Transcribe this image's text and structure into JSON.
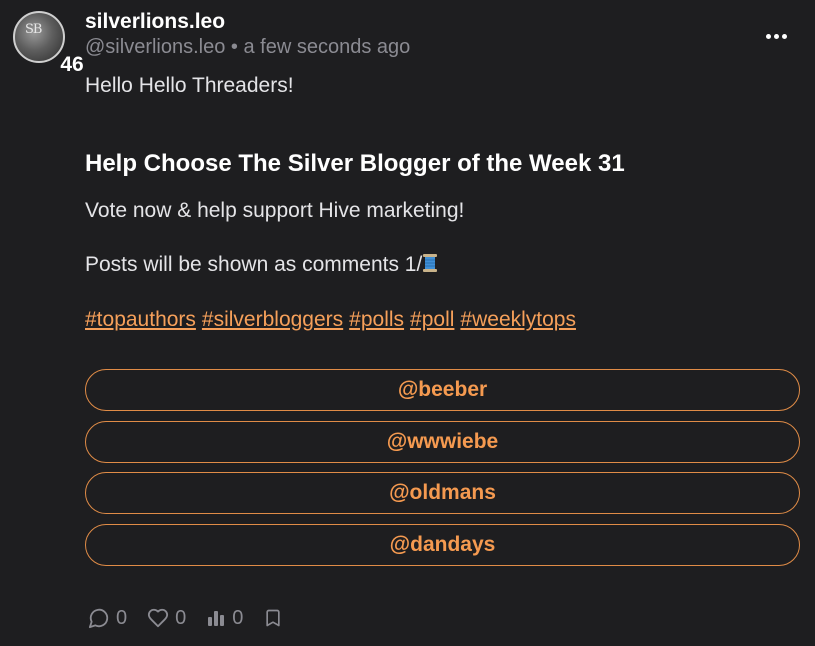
{
  "author": {
    "avatar_text": "SB",
    "reputation": "46",
    "name": "silverlions.leo",
    "handle": "@silverlions.leo",
    "separator": "•",
    "time": "a few seconds ago"
  },
  "menu": {
    "icon": "more-horizontal-icon"
  },
  "content": {
    "greeting": "Hello Hello Threaders!",
    "title": "Help Choose The Silver Blogger of the Week 31",
    "line1": "Vote now & help support Hive marketing!",
    "line2": "Posts will be shown as comments 1/",
    "line2_icon": "thread-spool-icon",
    "hashtags": [
      "#topauthors",
      "#silverbloggers",
      "#polls",
      "#poll",
      "#weeklytops"
    ]
  },
  "poll": {
    "options": [
      "@beeber",
      "@wwwiebe",
      "@oldmans",
      "@dandays"
    ]
  },
  "actions": {
    "comments": {
      "icon": "comment-icon",
      "count": "0"
    },
    "likes": {
      "icon": "heart-icon",
      "count": "0"
    },
    "stats": {
      "icon": "bar-chart-icon",
      "count": "0"
    },
    "bookmark": {
      "icon": "bookmark-icon"
    }
  },
  "colors": {
    "background": "#1e1e20",
    "accent": "#f59a50",
    "muted": "#8b8b92",
    "text": "#e4e4e7"
  }
}
